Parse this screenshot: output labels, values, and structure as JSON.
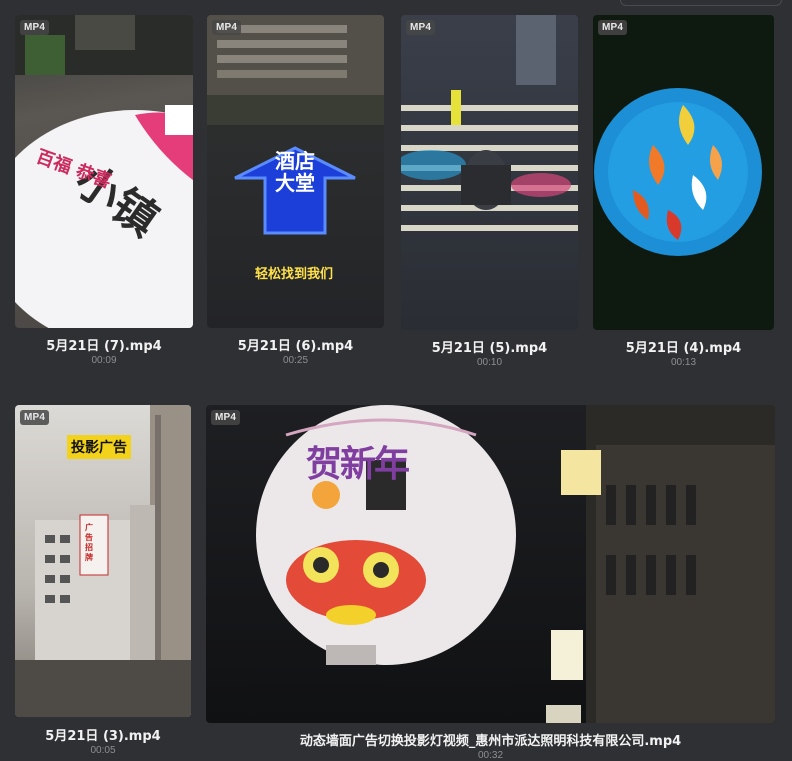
{
  "videos": [
    {
      "name": "5月21日 (7).mp4",
      "duration": "00:09",
      "badge": "MP4",
      "overlay": [
        "小镇",
        "百福 恭喜"
      ]
    },
    {
      "name": "5月21日 (6).mp4",
      "duration": "00:25",
      "badge": "MP4",
      "overlay": [
        "酒店大堂",
        "轻松找到我们"
      ]
    },
    {
      "name": "5月21日 (5).mp4",
      "duration": "00:10",
      "badge": "MP4",
      "overlay": []
    },
    {
      "name": "5月21日 (4).mp4",
      "duration": "00:13",
      "badge": "MP4",
      "overlay": []
    },
    {
      "name": "5月21日 (3).mp4",
      "duration": "00:05",
      "badge": "MP4",
      "overlay": [
        "投影广告",
        "广告招牌"
      ]
    },
    {
      "name": "动态墙面广告切换投影灯视频_惠州市派达照明科技有限公司.mp4",
      "duration": "00:32",
      "badge": "MP4",
      "overlay": [
        "贺新年"
      ]
    }
  ]
}
